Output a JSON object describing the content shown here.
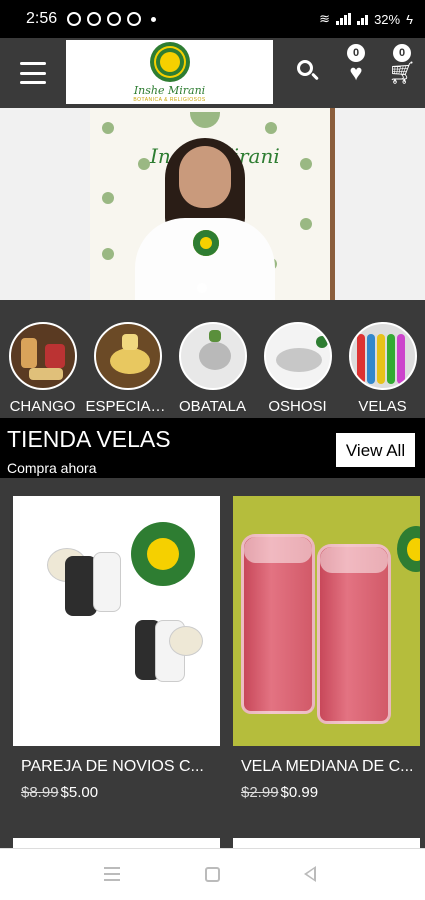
{
  "status_bar": {
    "time": "2:56",
    "battery": "32%"
  },
  "app_bar": {
    "logo_text": "Inshe Mirani",
    "logo_sub": "BOTANICA & RELIGIOSOS",
    "wishlist_count": "0",
    "cart_count": "0"
  },
  "banner": {
    "brand_text": "Inshe Mirani"
  },
  "categories": [
    {
      "label": "CHANGO"
    },
    {
      "label": "ESPECIAL..."
    },
    {
      "label": "OBATALA"
    },
    {
      "label": "OSHOSI"
    },
    {
      "label": "VELAS"
    }
  ],
  "section": {
    "title": "TIENDA VELAS",
    "subtitle": "Compra ahora",
    "view_all_label": "View All"
  },
  "products": [
    {
      "title": "PAREJA DE NOVIOS C...",
      "old_price": "$8.99",
      "price": "$5.00"
    },
    {
      "title": "VELA MEDIANA DE C...",
      "old_price": "$2.99",
      "price": "$0.99"
    }
  ],
  "colors": {
    "brand_green": "#2e7d32",
    "brand_yellow": "#f5d000",
    "app_bar": "#3a3a3a"
  }
}
